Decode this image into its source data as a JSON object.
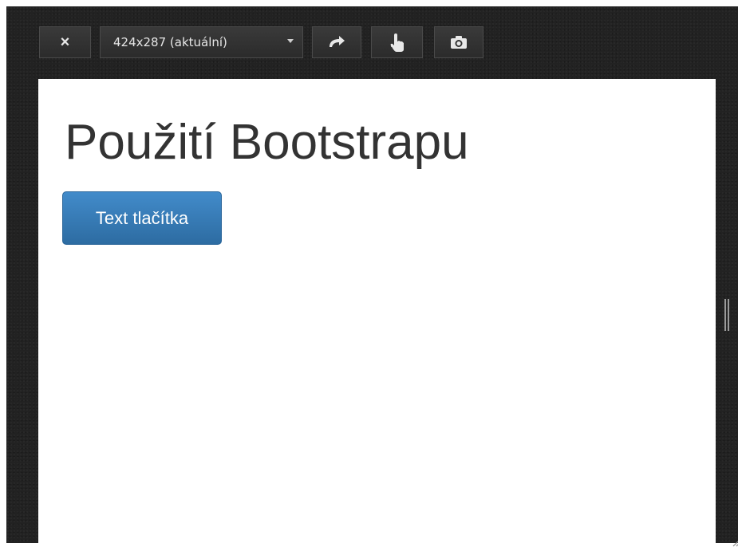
{
  "toolbar": {
    "close_label": "×",
    "device_size": "424x287 (aktuální)",
    "icons": [
      "close-icon",
      "chevron-down-icon",
      "rotate-icon",
      "touch-icon",
      "camera-icon"
    ]
  },
  "viewport": {
    "heading": "Použití Bootstrapu",
    "button_label": "Text tlačítka"
  },
  "colors": {
    "background": "#222222",
    "button_primary": "#337ab7",
    "heading_text": "#333333",
    "viewport_bg": "#ffffff"
  }
}
